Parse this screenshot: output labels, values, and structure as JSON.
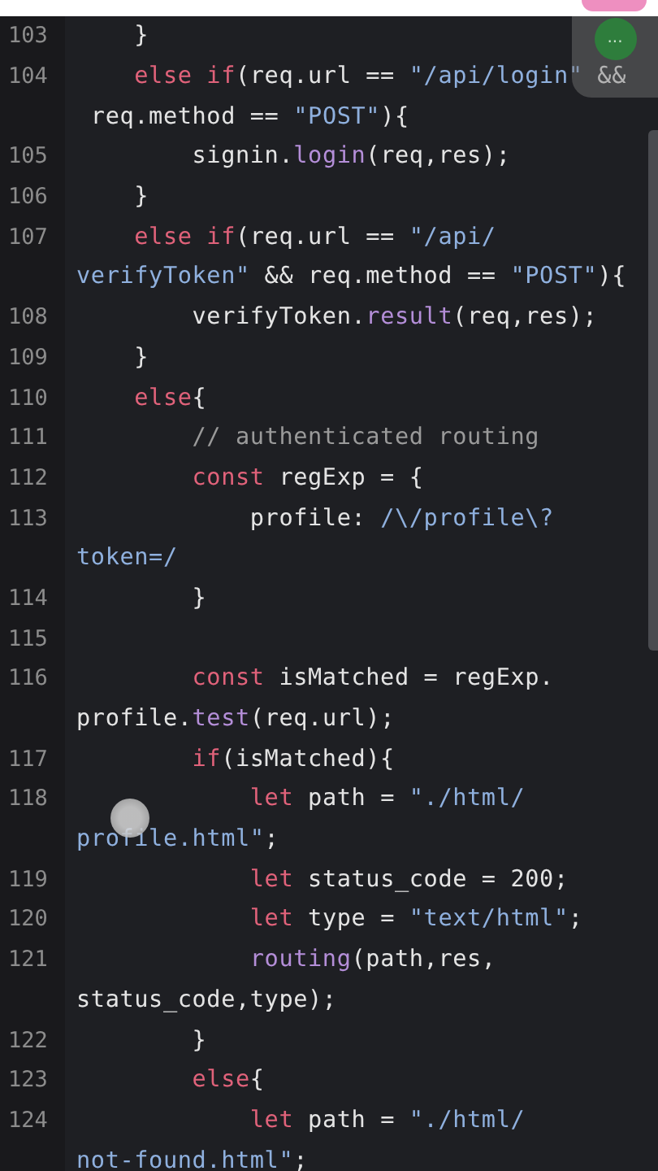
{
  "menu_button": {
    "label": "..."
  },
  "lines": [
    {
      "number": "103",
      "tokens": [
        {
          "kind": "plain",
          "text": "    }"
        }
      ]
    },
    {
      "number": "104",
      "tokens": [
        {
          "kind": "kw",
          "text": "    else if"
        },
        {
          "kind": "plain",
          "text": "(req.url == "
        },
        {
          "kind": "str",
          "text": "\"/api/login\""
        },
        {
          "kind": "plain",
          "text": " &&"
        },
        {
          "kind": "plain",
          "text": " req.method == ",
          "wrap": true
        },
        {
          "kind": "str",
          "text": "\"POST\""
        },
        {
          "kind": "plain",
          "text": "){"
        }
      ]
    },
    {
      "number": "105",
      "tokens": [
        {
          "kind": "plain",
          "text": "        signin."
        },
        {
          "kind": "fn",
          "text": "login"
        },
        {
          "kind": "plain",
          "text": "(req,res);"
        }
      ]
    },
    {
      "number": "106",
      "tokens": [
        {
          "kind": "plain",
          "text": "    }"
        }
      ]
    },
    {
      "number": "107",
      "tokens": [
        {
          "kind": "kw",
          "text": "    else if"
        },
        {
          "kind": "plain",
          "text": "(req.url == "
        },
        {
          "kind": "str",
          "text": "\"/api/"
        },
        {
          "kind": "str",
          "text": "verifyToken\"",
          "wrap": true
        },
        {
          "kind": "plain",
          "text": " && req.method == "
        },
        {
          "kind": "str",
          "text": "\"POST\""
        },
        {
          "kind": "plain",
          "text": "){"
        }
      ]
    },
    {
      "number": "108",
      "tokens": [
        {
          "kind": "plain",
          "text": "        verifyToken."
        },
        {
          "kind": "fn",
          "text": "result"
        },
        {
          "kind": "plain",
          "text": "(req,res);"
        }
      ]
    },
    {
      "number": "109",
      "tokens": [
        {
          "kind": "plain",
          "text": "    }"
        }
      ]
    },
    {
      "number": "110",
      "tokens": [
        {
          "kind": "kw",
          "text": "    else"
        },
        {
          "kind": "plain",
          "text": "{"
        }
      ]
    },
    {
      "number": "111",
      "tokens": [
        {
          "kind": "comment",
          "text": "        // authenticated routing"
        }
      ]
    },
    {
      "number": "112",
      "tokens": [
        {
          "kind": "kw",
          "text": "        const"
        },
        {
          "kind": "plain",
          "text": " regExp = {"
        }
      ]
    },
    {
      "number": "113",
      "tokens": [
        {
          "kind": "plain",
          "text": "            profile: "
        },
        {
          "kind": "str",
          "text": "/\\/profile\\?"
        },
        {
          "kind": "str",
          "text": "token=/",
          "wrap": true
        }
      ]
    },
    {
      "number": "114",
      "tokens": [
        {
          "kind": "plain",
          "text": "        }"
        }
      ]
    },
    {
      "number": "115"
    },
    {
      "number": "116",
      "tokens": [
        {
          "kind": "kw",
          "text": "        const"
        },
        {
          "kind": "plain",
          "text": " isMatched = regExp."
        },
        {
          "kind": "plain",
          "text": "profile.",
          "wrap": true
        },
        {
          "kind": "fn",
          "text": "test"
        },
        {
          "kind": "plain",
          "text": "(req.url);"
        }
      ]
    },
    {
      "number": "117",
      "tokens": [
        {
          "kind": "kw",
          "text": "        if"
        },
        {
          "kind": "plain",
          "text": "(isMatched){"
        }
      ]
    },
    {
      "number": "118",
      "tokens": [
        {
          "kind": "kw",
          "text": "            let"
        },
        {
          "kind": "plain",
          "text": " path = "
        },
        {
          "kind": "str",
          "text": "\"./html/"
        },
        {
          "kind": "str",
          "text": "profile.html\"",
          "wrap": true
        },
        {
          "kind": "plain",
          "text": ";"
        }
      ]
    },
    {
      "number": "119",
      "tokens": [
        {
          "kind": "kw",
          "text": "            let"
        },
        {
          "kind": "plain",
          "text": " status_code = 200;"
        }
      ]
    },
    {
      "number": "120",
      "tokens": [
        {
          "kind": "kw",
          "text": "            let"
        },
        {
          "kind": "plain",
          "text": " type = "
        },
        {
          "kind": "str",
          "text": "\"text/html\""
        },
        {
          "kind": "plain",
          "text": ";"
        }
      ]
    },
    {
      "number": "121",
      "tokens": [
        {
          "kind": "fn",
          "text": "            routing"
        },
        {
          "kind": "plain",
          "text": "(path,res,"
        },
        {
          "kind": "plain",
          "text": "status_code,type);",
          "wrap": true
        }
      ]
    },
    {
      "number": "122",
      "tokens": [
        {
          "kind": "plain",
          "text": "        }"
        }
      ]
    },
    {
      "number": "123",
      "tokens": [
        {
          "kind": "kw",
          "text": "        else"
        },
        {
          "kind": "plain",
          "text": "{"
        }
      ]
    },
    {
      "number": "124",
      "tokens": [
        {
          "kind": "kw",
          "text": "            let"
        },
        {
          "kind": "plain",
          "text": " path = "
        },
        {
          "kind": "str",
          "text": "\"./html/"
        },
        {
          "kind": "str",
          "text": "not-found.html\"",
          "wrap": true
        },
        {
          "kind": "plain",
          "text": ";"
        }
      ]
    }
  ]
}
